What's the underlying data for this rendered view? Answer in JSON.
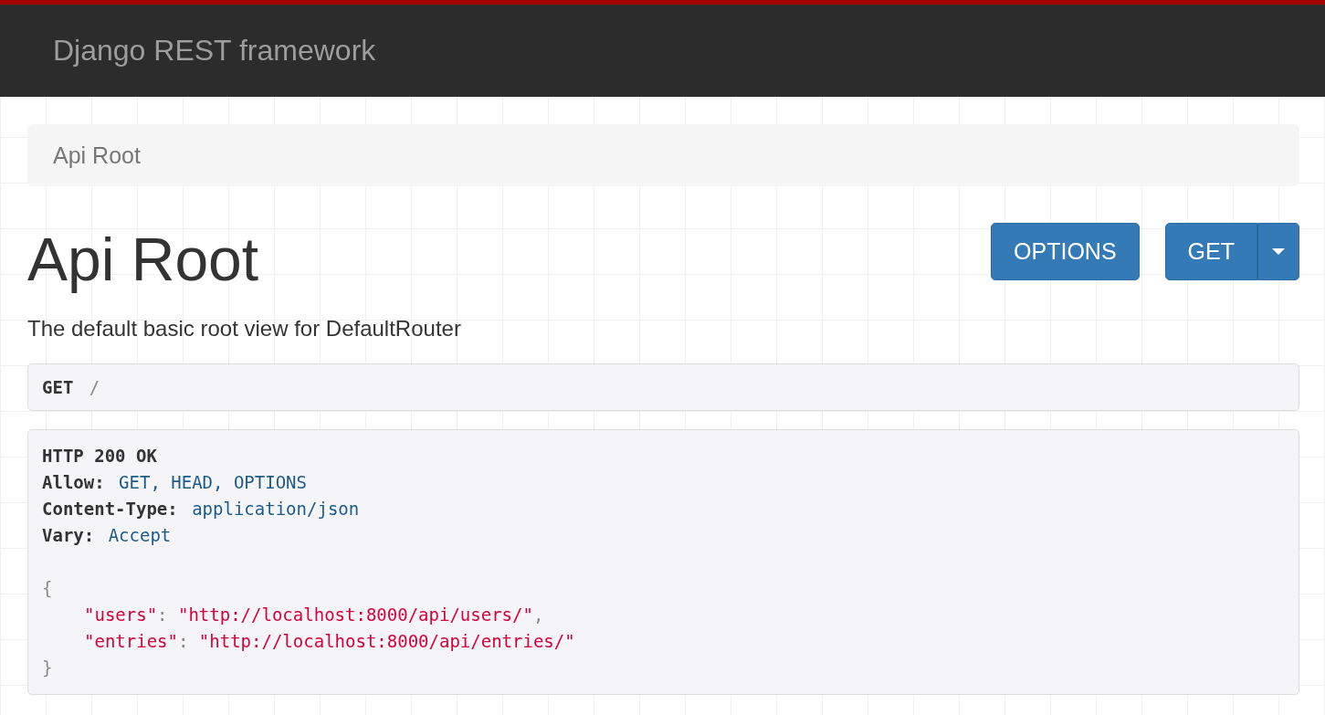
{
  "navbar": {
    "brand": "Django REST framework"
  },
  "breadcrumbs": [
    {
      "label": "Api Root"
    }
  ],
  "page": {
    "title": "Api Root",
    "description": "The default basic root view for DefaultRouter"
  },
  "buttons": [
    {
      "label": "OPTIONS",
      "kind": "plain"
    },
    {
      "label": "GET",
      "kind": "split"
    }
  ],
  "request": {
    "method": "GET",
    "path": "/"
  },
  "response": {
    "status": "HTTP 200 OK",
    "headers": [
      {
        "name": "Allow:",
        "value": "GET, HEAD, OPTIONS"
      },
      {
        "name": "Content-Type:",
        "value": "application/json"
      },
      {
        "name": "Vary:",
        "value": "Accept"
      }
    ],
    "body": {
      "open": "{",
      "entries": [
        {
          "key": "\"users\"",
          "colon": ":",
          "value": "\"http://localhost:8000/api/users/\"",
          "comma": ","
        },
        {
          "key": "\"entries\"",
          "colon": ":",
          "value": "\"http://localhost:8000/api/entries/\""
        }
      ],
      "close": "}"
    }
  }
}
